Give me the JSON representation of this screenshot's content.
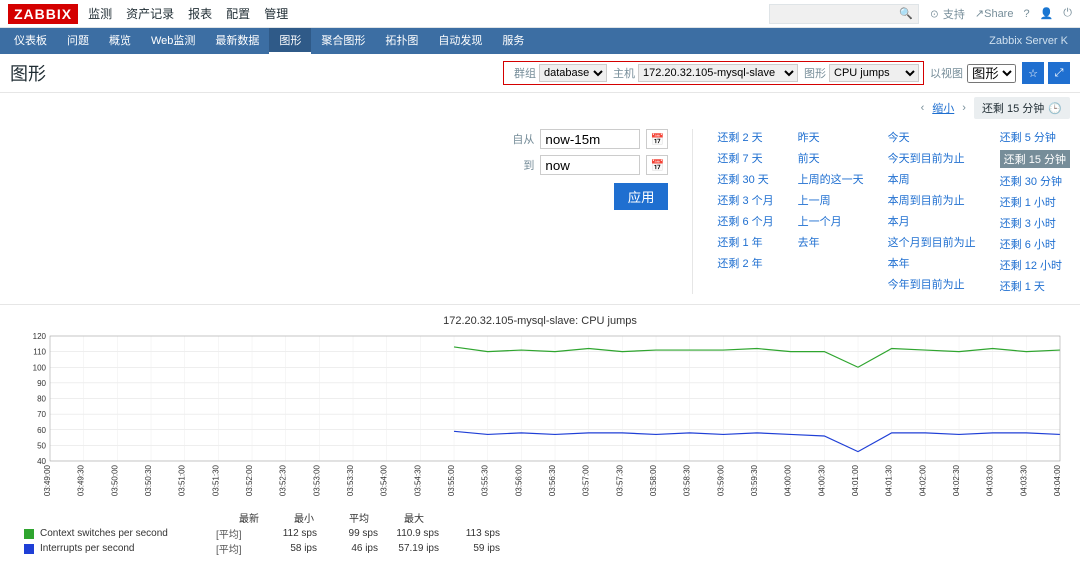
{
  "top": {
    "logo": "ZABBIX",
    "nav": [
      "监测",
      "资产记录",
      "报表",
      "配置",
      "管理"
    ],
    "support": "支持",
    "share": "Share"
  },
  "sub": {
    "items": [
      "仪表板",
      "问题",
      "概览",
      "Web监测",
      "最新数据",
      "图形",
      "聚合图形",
      "拓扑图",
      "自动发现",
      "服务"
    ],
    "active": "图形",
    "server": "Zabbix Server K"
  },
  "title": "图形",
  "selectors": {
    "group_label": "群组",
    "group_value": "database",
    "host_label": "主机",
    "host_value": "172.20.32.105-mysql-slave",
    "graph_label": "图形",
    "graph_value": "CPU jumps",
    "views_label": "以视图",
    "views_value": "图形"
  },
  "timebar": {
    "shrink": "缩小",
    "current": "还剩 15 分钟"
  },
  "timeform": {
    "from_label": "自从",
    "from_value": "now-15m",
    "to_label": "到",
    "to_value": "now",
    "apply": "应用"
  },
  "presets": {
    "col1": [
      "还剩 2 天",
      "还剩 7 天",
      "还剩 30 天",
      "还剩 3 个月",
      "还剩 6 个月",
      "还剩 1 年",
      "还剩 2 年"
    ],
    "col2": [
      "昨天",
      "前天",
      "上周的这一天",
      "上一周",
      "上一个月",
      "去年",
      ""
    ],
    "col3": [
      "今天",
      "今天到目前为止",
      "本周",
      "本周到目前为止",
      "本月",
      "这个月到目前为止",
      "本年",
      "今年到目前为止"
    ],
    "col4": [
      "还剩 5 分钟",
      "还剩 15 分钟",
      "还剩 30 分钟",
      "还剩 1 小时",
      "还剩 3 小时",
      "还剩 6 小时",
      "还剩 12 小时",
      "还剩 1 天"
    ],
    "selected": "还剩 15 分钟"
  },
  "chart_data": {
    "type": "line",
    "title": "172.20.32.105-mysql-slave: CPU jumps",
    "ylabel": "",
    "ylim": [
      40,
      120
    ],
    "yticks": [
      40,
      50,
      60,
      70,
      80,
      90,
      100,
      110,
      120
    ],
    "x_start": "05-01 03:49",
    "x_end": "05-01 04:04",
    "xticks": [
      "03:49:00",
      "03:49:30",
      "03:50:00",
      "03:50:30",
      "03:51:00",
      "03:51:30",
      "03:52:00",
      "03:52:30",
      "03:53:00",
      "03:53:30",
      "03:54:00",
      "03:54:30",
      "03:55:00",
      "03:55:30",
      "03:56:00",
      "03:56:30",
      "03:57:00",
      "03:57:30",
      "03:58:00",
      "03:58:30",
      "03:59:00",
      "03:59:30",
      "04:00:00",
      "04:00:30",
      "04:01:00",
      "04:01:30",
      "04:02:00",
      "04:02:30",
      "04:03:00",
      "04:03:30",
      "04:04:00"
    ],
    "xtick_red_indices": [
      0,
      2,
      4,
      6,
      8,
      10,
      12,
      14,
      16,
      18,
      20,
      22,
      24,
      26,
      28,
      30
    ],
    "series": [
      {
        "name": "Context switches per second",
        "color": "#2fa52f",
        "values": [
          null,
          null,
          null,
          null,
          null,
          null,
          null,
          null,
          null,
          null,
          null,
          null,
          113,
          110,
          111,
          110,
          112,
          110,
          111,
          111,
          111,
          112,
          110,
          110,
          100,
          112,
          111,
          110,
          112,
          110,
          111
        ]
      },
      {
        "name": "Interrupts per second",
        "color": "#1f3fd6",
        "values": [
          null,
          null,
          null,
          null,
          null,
          null,
          null,
          null,
          null,
          null,
          null,
          null,
          59,
          57,
          58,
          57,
          58,
          58,
          57,
          58,
          57,
          58,
          57,
          56,
          46,
          58,
          58,
          57,
          58,
          58,
          57
        ]
      }
    ]
  },
  "legend": {
    "headers": [
      "最新",
      "最小",
      "平均",
      "最大"
    ],
    "rows": [
      {
        "color": "#2fa52f",
        "name": "Context switches per second",
        "label": "[平均]",
        "latest": "112 sps",
        "min": "99 sps",
        "avg": "110.9 sps",
        "max": "113 sps"
      },
      {
        "color": "#1f3fd6",
        "name": "Interrupts per second",
        "label": "[平均]",
        "latest": "58 ips",
        "min": "46 ips",
        "avg": "57.19 ips",
        "max": "59 ips"
      }
    ]
  }
}
